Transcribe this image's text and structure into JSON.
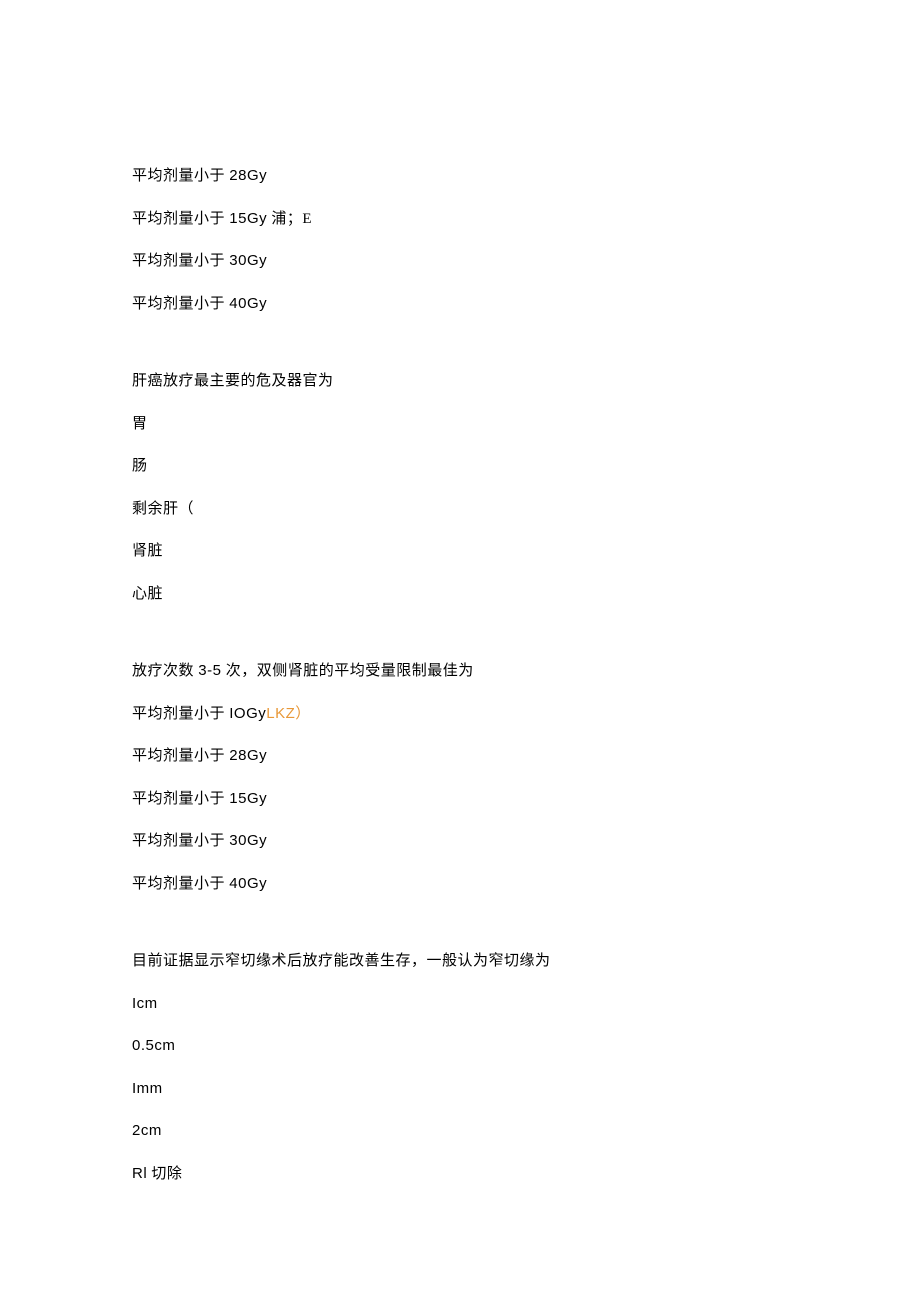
{
  "block1": {
    "line1_prefix": "平均剂量小于 ",
    "line1_suffix": "28Gy",
    "line2_prefix": "平均剂量小于 ",
    "line2_mid": "15Gy",
    "line2_suffix": " 浦；E",
    "line3_prefix": "平均剂量小于 ",
    "line3_suffix": "30Gy",
    "line4_prefix": "平均剂量小于 ",
    "line4_suffix": "40Gy"
  },
  "block2": {
    "question": "肝癌放疗最主要的危及器官为",
    "opt1": "胃",
    "opt2": "肠",
    "opt3": "剩余肝（",
    "opt4": "肾脏",
    "opt5": "心脏"
  },
  "block3": {
    "question_prefix": "放疗次数 ",
    "question_mid": "3-5",
    "question_suffix": " 次，双侧肾脏的平均受量限制最佳为",
    "line1_prefix": "平均剂量小于 ",
    "line1_mid": "IOGy",
    "line1_highlight": "LKZ）",
    "line2_prefix": "平均剂量小于 ",
    "line2_suffix": "28Gy",
    "line3_prefix": "平均剂量小于 ",
    "line3_suffix": "15Gy",
    "line4_prefix": "平均剂量小于 ",
    "line4_suffix": "30Gy",
    "line5_prefix": "平均剂量小于 ",
    "line5_suffix": "40Gy"
  },
  "block4": {
    "question": "目前证据显示窄切缘术后放疗能改善生存，一般认为窄切缘为",
    "opt1": "Icm",
    "opt2": "0.5cm",
    "opt3": "Imm",
    "opt4": "2cm",
    "opt5_prefix": "Rl",
    "opt5_suffix": " 切除"
  }
}
